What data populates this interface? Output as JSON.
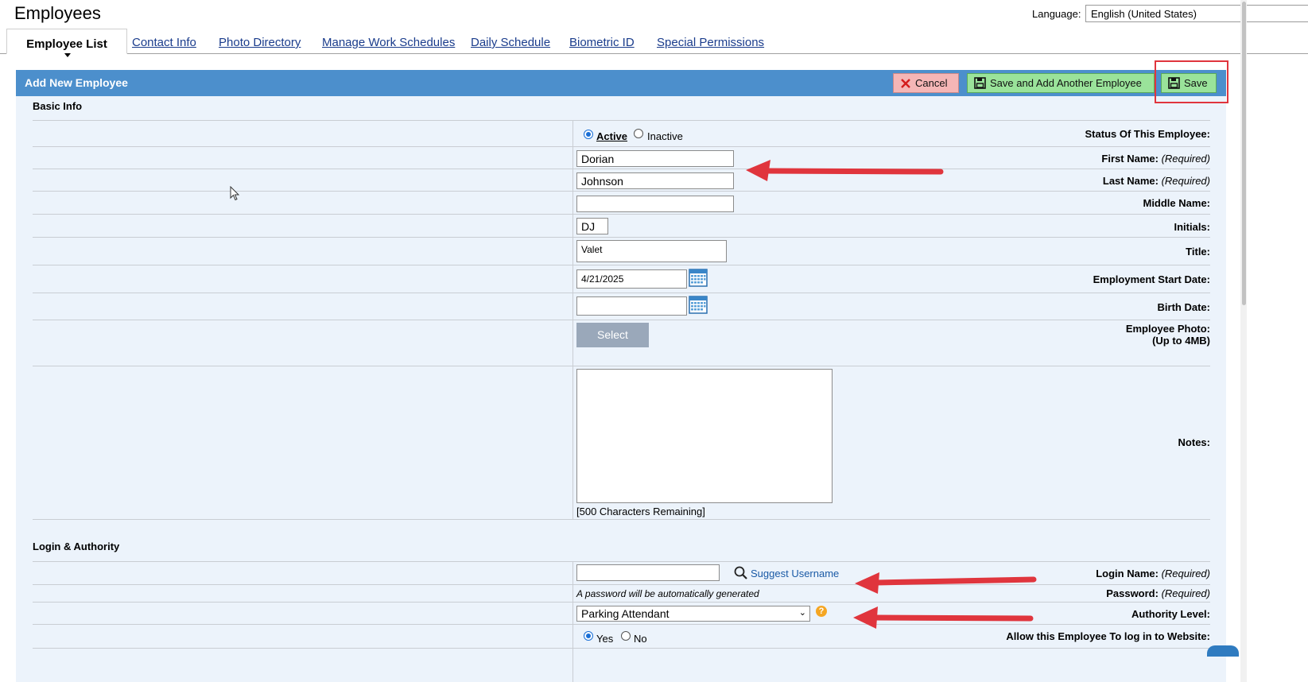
{
  "page": {
    "title": "Employees",
    "language_label": "Language:",
    "language_value": "English (United States)"
  },
  "tabs": {
    "active": "Employee List",
    "links": [
      "Contact Info",
      "Photo Directory",
      "Manage Work Schedules",
      "Daily Schedule",
      "Biometric ID",
      "Special Permissions"
    ]
  },
  "panel": {
    "title": "Add New Employee",
    "cancel_label": "Cancel",
    "save_add_label": "Save and Add Another Employee",
    "save_label": "Save"
  },
  "basic_info": {
    "section_title": "Basic Info",
    "status_label": "Status Of This Employee:",
    "status_active": "Active",
    "status_inactive": "Inactive",
    "status_selected": "Active",
    "first_name_label": "First Name:",
    "first_name_value": "Dorian",
    "last_name_label": "Last Name:",
    "last_name_value": "Johnson",
    "required_text": "(Required)",
    "middle_name_label": "Middle Name:",
    "middle_name_value": "",
    "initials_label": "Initials:",
    "initials_value": "DJ",
    "title_label": "Title:",
    "title_value": "Valet",
    "start_date_label": "Employment Start Date:",
    "start_date_value": "4/21/2025",
    "birth_date_label": "Birth Date:",
    "birth_date_value": "",
    "photo_label": "Employee Photo:",
    "photo_sub_label": "(Up to 4MB)",
    "photo_button": "Select",
    "notes_label": "Notes:",
    "notes_value": "",
    "chars_remaining": "[500 Characters Remaining]"
  },
  "login": {
    "section_title": "Login & Authority",
    "login_name_label": "Login Name:",
    "login_name_value": "",
    "suggest_username": "Suggest Username",
    "password_label": "Password:",
    "password_note": "A password will be automatically generated",
    "authority_label": "Authority Level:",
    "authority_value": "Parking Attendant",
    "help_glyph": "?",
    "allow_login_label": "Allow this Employee To log in to Website:",
    "allow_yes": "Yes",
    "allow_no": "No",
    "allow_selected": "Yes"
  },
  "colors": {
    "header_blue": "#4c8fcc",
    "panel_bg": "#ecf3fb",
    "save_green": "#9ae39a",
    "cancel_red": "#f5b6b6",
    "annotation_red": "#e0353d"
  },
  "icons": [
    "close-icon",
    "floppy-disk-icon",
    "calendar-icon",
    "magnifier-icon",
    "help-icon",
    "chevron-down-icon",
    "mouse-cursor-icon",
    "red-arrow-annotation"
  ]
}
